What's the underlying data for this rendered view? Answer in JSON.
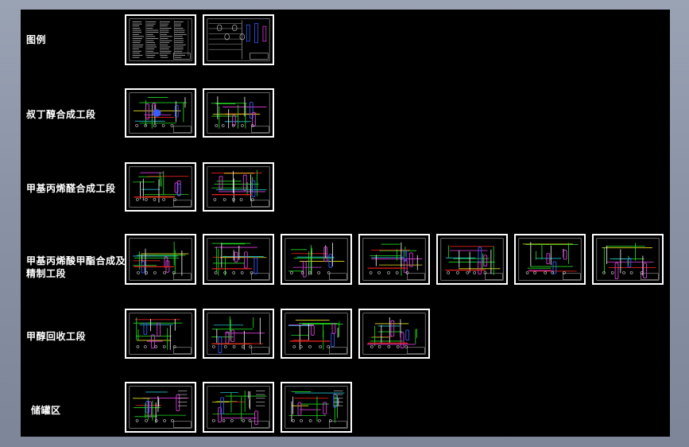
{
  "rows": [
    {
      "label": "图例",
      "sheets": 2,
      "kind": "legend"
    },
    {
      "label": "叔丁醇合成工段",
      "sheets": 2,
      "kind": "pid"
    },
    {
      "label": "甲基丙烯醛合成工段",
      "sheets": 2,
      "kind": "pid"
    },
    {
      "label": "甲基丙烯酸甲酯合成及精制工段",
      "sheets": 7,
      "kind": "pid"
    },
    {
      "label": "甲醇回收工段",
      "sheets": 4,
      "kind": "pid"
    },
    {
      "label": "储罐区",
      "sheets": 3,
      "kind": "pid"
    }
  ],
  "colors": {
    "page": "#000000",
    "frame": "#ffffff",
    "line_green": "#22d622",
    "line_red": "#e0201c",
    "line_blue": "#3a5cff",
    "line_magenta": "#e040e0",
    "line_cyan": "#20c0d0",
    "line_yellow": "#e8e020"
  }
}
